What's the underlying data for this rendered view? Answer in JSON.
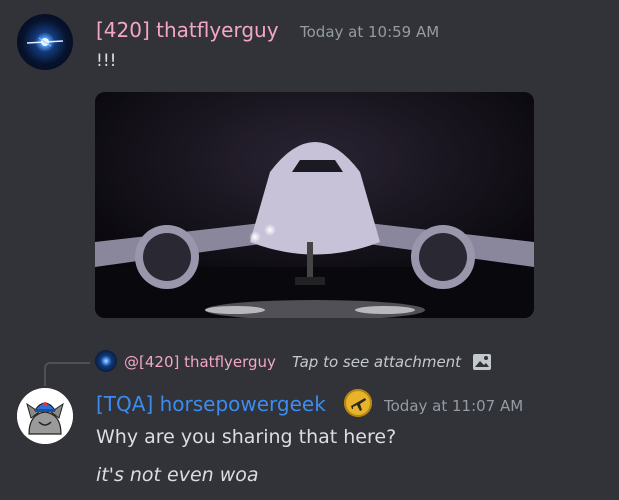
{
  "messages": [
    {
      "author": "[420] thatflyerguy",
      "timestamp": "Today at 10:59 AM",
      "text": "!!!",
      "avatar_icon": "airplane-night-avatar",
      "attachment": {
        "type": "image",
        "description_icon": "airplane-night-photo"
      },
      "author_color": "#f4a6c8"
    },
    {
      "reply_to": {
        "author": "@[420] thatflyerguy",
        "text": "Tap to see attachment",
        "icon": "image-icon"
      },
      "author": "[TQA] horsepowergeek",
      "timestamp": "Today at 11:07 AM",
      "badge_icon": "airplane-badge-icon",
      "avatar_icon": "cat-cap-avatar",
      "author_color": "#3c8cf0",
      "lines": [
        "Why are you sharing that here?",
        "it's not even woa"
      ]
    }
  ],
  "theme": {
    "background": "#313338",
    "text": "#dbdee1",
    "muted": "#949ba4"
  }
}
